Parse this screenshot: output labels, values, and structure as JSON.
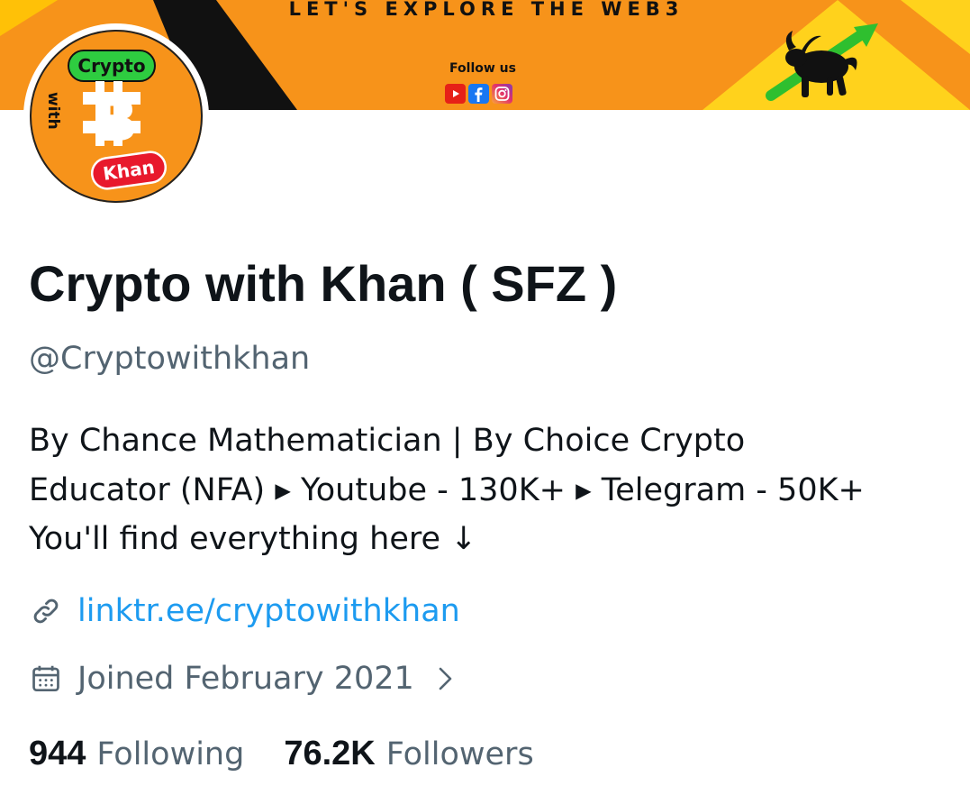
{
  "banner": {
    "tagline": "LET'S EXPLORE THE WEB3",
    "follow_us": "Follow us",
    "socials": [
      "youtube",
      "facebook",
      "instagram"
    ],
    "brand_color": "#f7931a"
  },
  "avatar": {
    "text_top": "Crypto",
    "text_side": "with",
    "text_bottom": "Khan",
    "symbol": "B"
  },
  "profile": {
    "display_name": "Crypto with Khan ( SFZ )",
    "handle": "@Cryptowithkhan",
    "bio_lines": [
      "By Chance Mathematician | By Choice Crypto",
      "Educator (NFA)  ▸ Youtube - 130K+ ▸ Telegram - 50K+",
      "You'll find everything here ↓"
    ],
    "link": "linktr.ee/cryptowithkhan",
    "joined": "Joined February 2021",
    "following_count": "944",
    "following_label": "Following",
    "followers_count": "76.2K",
    "followers_label": "Followers"
  },
  "icons": {
    "link": "link-icon",
    "calendar": "calendar-icon",
    "chevron": "chevron-right-icon"
  },
  "colors": {
    "text_primary": "#0f1419",
    "text_secondary": "#536471",
    "link": "#1d9bf0"
  }
}
